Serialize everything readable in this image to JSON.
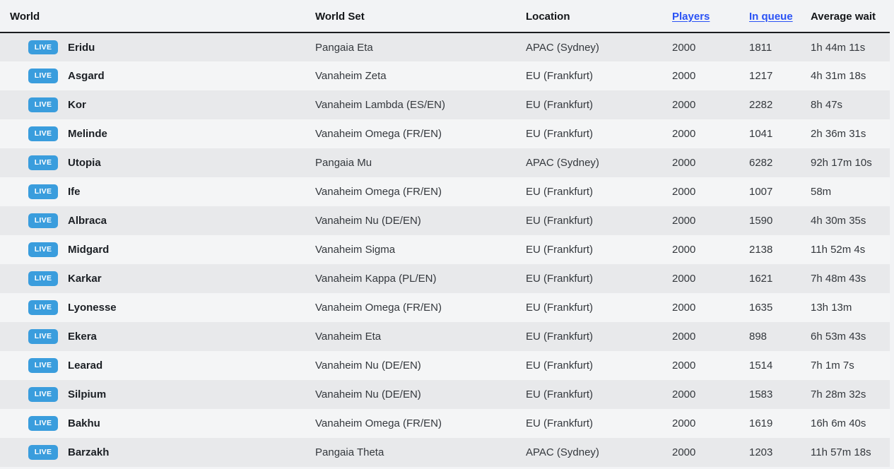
{
  "table": {
    "columns": [
      {
        "key": "world",
        "label": "World",
        "sortable": false
      },
      {
        "key": "world_set",
        "label": "World Set",
        "sortable": false
      },
      {
        "key": "location",
        "label": "Location",
        "sortable": false
      },
      {
        "key": "players",
        "label": "Players",
        "sortable": true
      },
      {
        "key": "in_queue",
        "label": "In queue",
        "sortable": true
      },
      {
        "key": "avg_wait",
        "label": "Average wait",
        "sortable": false
      }
    ],
    "status_badge_label": "LIVE",
    "link_color": "#2a52f5",
    "badge_color": "#3a9ddd",
    "rows": [
      {
        "status": "LIVE",
        "world": "Eridu",
        "world_set": "Pangaia Eta",
        "location": "APAC (Sydney)",
        "players": "2000",
        "in_queue": "1811",
        "avg_wait": "1h 44m 11s"
      },
      {
        "status": "LIVE",
        "world": "Asgard",
        "world_set": "Vanaheim Zeta",
        "location": "EU (Frankfurt)",
        "players": "2000",
        "in_queue": "1217",
        "avg_wait": "4h 31m 18s"
      },
      {
        "status": "LIVE",
        "world": "Kor",
        "world_set": "Vanaheim Lambda (ES/EN)",
        "location": "EU (Frankfurt)",
        "players": "2000",
        "in_queue": "2282",
        "avg_wait": "8h 47s"
      },
      {
        "status": "LIVE",
        "world": "Melinde",
        "world_set": "Vanaheim Omega (FR/EN)",
        "location": "EU (Frankfurt)",
        "players": "2000",
        "in_queue": "1041",
        "avg_wait": "2h 36m 31s"
      },
      {
        "status": "LIVE",
        "world": "Utopia",
        "world_set": "Pangaia Mu",
        "location": "APAC (Sydney)",
        "players": "2000",
        "in_queue": "6282",
        "avg_wait": "92h 17m 10s"
      },
      {
        "status": "LIVE",
        "world": "Ife",
        "world_set": "Vanaheim Omega (FR/EN)",
        "location": "EU (Frankfurt)",
        "players": "2000",
        "in_queue": "1007",
        "avg_wait": "58m"
      },
      {
        "status": "LIVE",
        "world": "Albraca",
        "world_set": "Vanaheim Nu (DE/EN)",
        "location": "EU (Frankfurt)",
        "players": "2000",
        "in_queue": "1590",
        "avg_wait": "4h 30m 35s"
      },
      {
        "status": "LIVE",
        "world": "Midgard",
        "world_set": "Vanaheim Sigma",
        "location": "EU (Frankfurt)",
        "players": "2000",
        "in_queue": "2138",
        "avg_wait": "11h 52m 4s"
      },
      {
        "status": "LIVE",
        "world": "Karkar",
        "world_set": "Vanaheim Kappa (PL/EN)",
        "location": "EU (Frankfurt)",
        "players": "2000",
        "in_queue": "1621",
        "avg_wait": "7h 48m 43s"
      },
      {
        "status": "LIVE",
        "world": "Lyonesse",
        "world_set": "Vanaheim Omega (FR/EN)",
        "location": "EU (Frankfurt)",
        "players": "2000",
        "in_queue": "1635",
        "avg_wait": "13h 13m"
      },
      {
        "status": "LIVE",
        "world": "Ekera",
        "world_set": "Vanaheim Eta",
        "location": "EU (Frankfurt)",
        "players": "2000",
        "in_queue": "898",
        "avg_wait": "6h 53m 43s"
      },
      {
        "status": "LIVE",
        "world": "Learad",
        "world_set": "Vanaheim Nu (DE/EN)",
        "location": "EU (Frankfurt)",
        "players": "2000",
        "in_queue": "1514",
        "avg_wait": "7h 1m 7s"
      },
      {
        "status": "LIVE",
        "world": "Silpium",
        "world_set": "Vanaheim Nu (DE/EN)",
        "location": "EU (Frankfurt)",
        "players": "2000",
        "in_queue": "1583",
        "avg_wait": "7h 28m 32s"
      },
      {
        "status": "LIVE",
        "world": "Bakhu",
        "world_set": "Vanaheim Omega (FR/EN)",
        "location": "EU (Frankfurt)",
        "players": "2000",
        "in_queue": "1619",
        "avg_wait": "16h 6m 40s"
      },
      {
        "status": "LIVE",
        "world": "Barzakh",
        "world_set": "Pangaia Theta",
        "location": "APAC (Sydney)",
        "players": "2000",
        "in_queue": "1203",
        "avg_wait": "11h 57m 18s"
      }
    ]
  }
}
